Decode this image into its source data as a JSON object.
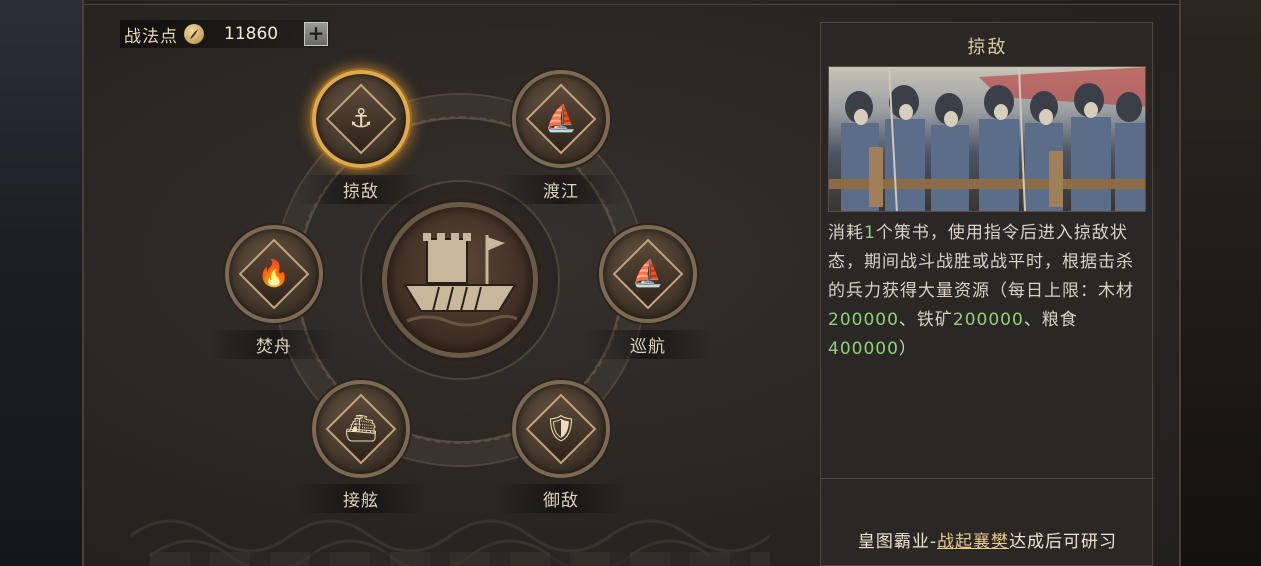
{
  "points": {
    "label": "战法点",
    "icon": "quill-coin-icon",
    "value": "11860",
    "add_label": "+"
  },
  "center": {
    "icon": "warship-icon"
  },
  "skills": [
    {
      "id": "lueDi",
      "label": "掠敌",
      "icon": "anchor-chain-icon",
      "selected": true
    },
    {
      "id": "duJiang",
      "label": "渡江",
      "icon": "junk-ship-icon",
      "selected": false
    },
    {
      "id": "fenZhou",
      "label": "焚舟",
      "icon": "burning-ship-icon",
      "selected": false
    },
    {
      "id": "xunHang",
      "label": "巡航",
      "icon": "sailing-ship-icon",
      "selected": false
    },
    {
      "id": "jieXian",
      "label": "接舷",
      "icon": "boarding-ship-icon",
      "selected": false
    },
    {
      "id": "yuDi",
      "label": "御敌",
      "icon": "soldier-shield-icon",
      "selected": false
    }
  ],
  "detail": {
    "title": "掠敌",
    "image_icon": "soldiers-illustration",
    "desc_parts": {
      "p1": "消耗",
      "n1": "1",
      "p2": "个策书，使用指令后进入掠敌状态，期间战斗战胜或战平时，根据击杀的兵力获得大量资源（每日上限：木材",
      "n2": "200000",
      "p3": "、铁矿",
      "n3": "200000",
      "p4": "、粮食",
      "n4": "400000",
      "p5": "）"
    },
    "unlock_prefix": "皇图霸业-",
    "unlock_link": "战起襄樊",
    "unlock_suffix": "达成后可研习"
  },
  "colors": {
    "accent_gold": "#e0a94a",
    "highlight_green": "#8fd07e",
    "link_gold": "#e8c98e"
  }
}
